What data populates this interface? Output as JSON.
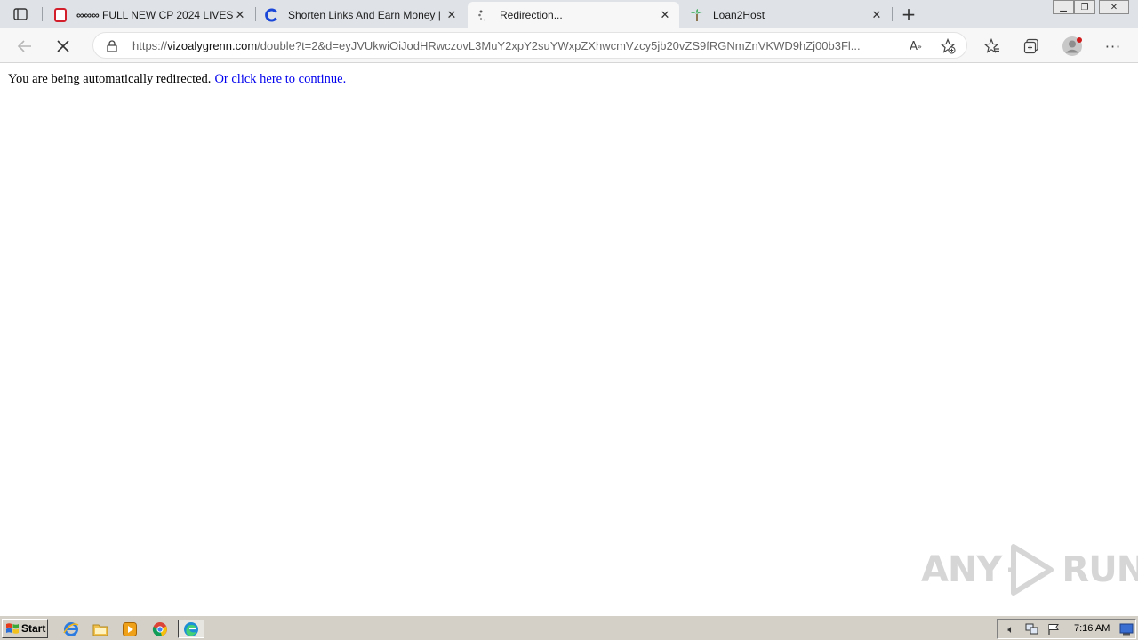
{
  "tabs": [
    {
      "title": "FULL NEW CP 2024 LIVES",
      "favicon": "red-bookmark-icon",
      "prefix": "∞∞∞"
    },
    {
      "title": "Shorten Links And Earn Money | ...",
      "favicon": "shortener-c-icon"
    },
    {
      "title": "Redirection...",
      "favicon": "loading-spinner-icon",
      "active": true
    },
    {
      "title": "Loan2Host",
      "favicon": "loan2host-palm-icon"
    }
  ],
  "omnibox": {
    "url_scheme": "https://",
    "url_host": "vizoalygrenn.com",
    "url_path": "/double?t=2&d=eyJVUkwiOiJodHRwczovL3MuY2xpY2suYWxpZXhwcmVzcy5jb20vZS9fRGNmZnVKWD9hZj00b3Fl..."
  },
  "content": {
    "message": "You are being automatically redirected.",
    "link_text": "Or click here to continue."
  },
  "watermark": {
    "left": "ANY",
    "right": "RUN"
  },
  "taskbar": {
    "start_label": "Start",
    "clock": "7:16 AM"
  },
  "colors": {
    "link": "#0000ee",
    "tabstrip": "#dfe3e8",
    "taskbar": "#d4d0c8"
  }
}
